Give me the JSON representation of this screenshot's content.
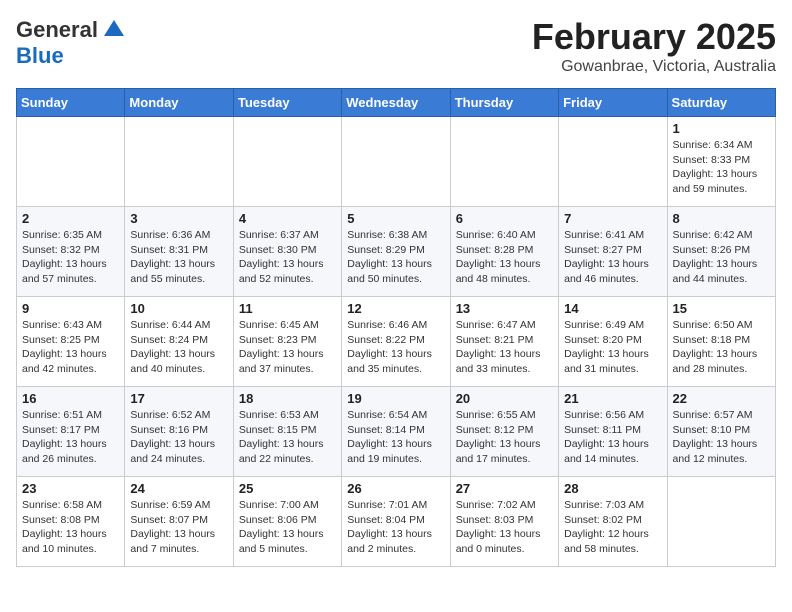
{
  "header": {
    "logo_general": "General",
    "logo_blue": "Blue",
    "title": "February 2025",
    "subtitle": "Gowanbrae, Victoria, Australia"
  },
  "calendar": {
    "days_of_week": [
      "Sunday",
      "Monday",
      "Tuesday",
      "Wednesday",
      "Thursday",
      "Friday",
      "Saturday"
    ],
    "weeks": [
      [
        {
          "day": "",
          "detail": ""
        },
        {
          "day": "",
          "detail": ""
        },
        {
          "day": "",
          "detail": ""
        },
        {
          "day": "",
          "detail": ""
        },
        {
          "day": "",
          "detail": ""
        },
        {
          "day": "",
          "detail": ""
        },
        {
          "day": "1",
          "detail": "Sunrise: 6:34 AM\nSunset: 8:33 PM\nDaylight: 13 hours and 59 minutes."
        }
      ],
      [
        {
          "day": "2",
          "detail": "Sunrise: 6:35 AM\nSunset: 8:32 PM\nDaylight: 13 hours and 57 minutes."
        },
        {
          "day": "3",
          "detail": "Sunrise: 6:36 AM\nSunset: 8:31 PM\nDaylight: 13 hours and 55 minutes."
        },
        {
          "day": "4",
          "detail": "Sunrise: 6:37 AM\nSunset: 8:30 PM\nDaylight: 13 hours and 52 minutes."
        },
        {
          "day": "5",
          "detail": "Sunrise: 6:38 AM\nSunset: 8:29 PM\nDaylight: 13 hours and 50 minutes."
        },
        {
          "day": "6",
          "detail": "Sunrise: 6:40 AM\nSunset: 8:28 PM\nDaylight: 13 hours and 48 minutes."
        },
        {
          "day": "7",
          "detail": "Sunrise: 6:41 AM\nSunset: 8:27 PM\nDaylight: 13 hours and 46 minutes."
        },
        {
          "day": "8",
          "detail": "Sunrise: 6:42 AM\nSunset: 8:26 PM\nDaylight: 13 hours and 44 minutes."
        }
      ],
      [
        {
          "day": "9",
          "detail": "Sunrise: 6:43 AM\nSunset: 8:25 PM\nDaylight: 13 hours and 42 minutes."
        },
        {
          "day": "10",
          "detail": "Sunrise: 6:44 AM\nSunset: 8:24 PM\nDaylight: 13 hours and 40 minutes."
        },
        {
          "day": "11",
          "detail": "Sunrise: 6:45 AM\nSunset: 8:23 PM\nDaylight: 13 hours and 37 minutes."
        },
        {
          "day": "12",
          "detail": "Sunrise: 6:46 AM\nSunset: 8:22 PM\nDaylight: 13 hours and 35 minutes."
        },
        {
          "day": "13",
          "detail": "Sunrise: 6:47 AM\nSunset: 8:21 PM\nDaylight: 13 hours and 33 minutes."
        },
        {
          "day": "14",
          "detail": "Sunrise: 6:49 AM\nSunset: 8:20 PM\nDaylight: 13 hours and 31 minutes."
        },
        {
          "day": "15",
          "detail": "Sunrise: 6:50 AM\nSunset: 8:18 PM\nDaylight: 13 hours and 28 minutes."
        }
      ],
      [
        {
          "day": "16",
          "detail": "Sunrise: 6:51 AM\nSunset: 8:17 PM\nDaylight: 13 hours and 26 minutes."
        },
        {
          "day": "17",
          "detail": "Sunrise: 6:52 AM\nSunset: 8:16 PM\nDaylight: 13 hours and 24 minutes."
        },
        {
          "day": "18",
          "detail": "Sunrise: 6:53 AM\nSunset: 8:15 PM\nDaylight: 13 hours and 22 minutes."
        },
        {
          "day": "19",
          "detail": "Sunrise: 6:54 AM\nSunset: 8:14 PM\nDaylight: 13 hours and 19 minutes."
        },
        {
          "day": "20",
          "detail": "Sunrise: 6:55 AM\nSunset: 8:12 PM\nDaylight: 13 hours and 17 minutes."
        },
        {
          "day": "21",
          "detail": "Sunrise: 6:56 AM\nSunset: 8:11 PM\nDaylight: 13 hours and 14 minutes."
        },
        {
          "day": "22",
          "detail": "Sunrise: 6:57 AM\nSunset: 8:10 PM\nDaylight: 13 hours and 12 minutes."
        }
      ],
      [
        {
          "day": "23",
          "detail": "Sunrise: 6:58 AM\nSunset: 8:08 PM\nDaylight: 13 hours and 10 minutes."
        },
        {
          "day": "24",
          "detail": "Sunrise: 6:59 AM\nSunset: 8:07 PM\nDaylight: 13 hours and 7 minutes."
        },
        {
          "day": "25",
          "detail": "Sunrise: 7:00 AM\nSunset: 8:06 PM\nDaylight: 13 hours and 5 minutes."
        },
        {
          "day": "26",
          "detail": "Sunrise: 7:01 AM\nSunset: 8:04 PM\nDaylight: 13 hours and 2 minutes."
        },
        {
          "day": "27",
          "detail": "Sunrise: 7:02 AM\nSunset: 8:03 PM\nDaylight: 13 hours and 0 minutes."
        },
        {
          "day": "28",
          "detail": "Sunrise: 7:03 AM\nSunset: 8:02 PM\nDaylight: 12 hours and 58 minutes."
        },
        {
          "day": "",
          "detail": ""
        }
      ]
    ]
  }
}
